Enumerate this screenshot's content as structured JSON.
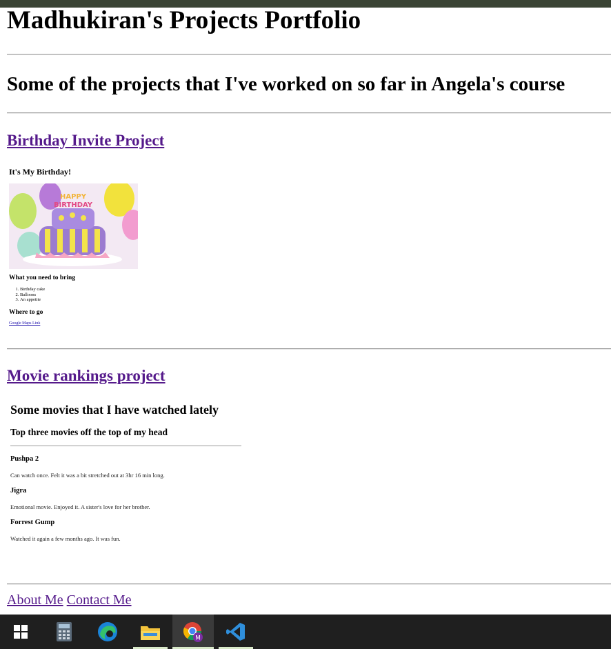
{
  "page": {
    "title": "Madhukiran's Projects Portfolio",
    "subtitle": "Some of the projects that I've worked on so far in Angela's course"
  },
  "projects": [
    {
      "link_label": "Birthday Invite Project",
      "preview": {
        "title": "It's My Birthday!",
        "image_alt": "Happy Birthday cake",
        "bring_heading": "What you need to bring",
        "bring_items": [
          "Birthday cake",
          "Balloons",
          "An appetite"
        ],
        "where_heading": "Where to go",
        "map_link": "Google Maps Link"
      }
    },
    {
      "link_label": "Movie rankings project",
      "preview": {
        "heading": "Some movies that I have watched lately",
        "subheading": "Top three movies off the top of my head",
        "movies": [
          {
            "title": "Pushpa 2",
            "desc": "Can watch once. Felt it was a bit stretched out at 3hr 16 min long."
          },
          {
            "title": "Jigra",
            "desc": "Emotional movie. Enjoyed it. A sister's love for her brother."
          },
          {
            "title": "Forrest Gump",
            "desc": "Watched it again a few months ago. It was fun."
          }
        ]
      }
    }
  ],
  "footer": {
    "about": "About Me",
    "contact": "Contact Me"
  },
  "taskbar": {
    "items": [
      "windows-start-icon",
      "calculator-icon",
      "edge-icon",
      "file-explorer-icon",
      "chrome-icon",
      "vscode-icon"
    ],
    "colors": {
      "background": "#1f1f1f",
      "active": "#3a3a3a",
      "indicator": "#d8e8c8"
    }
  },
  "colors": {
    "visited_link": "#551a8b",
    "top_strip": "#3a4434"
  }
}
